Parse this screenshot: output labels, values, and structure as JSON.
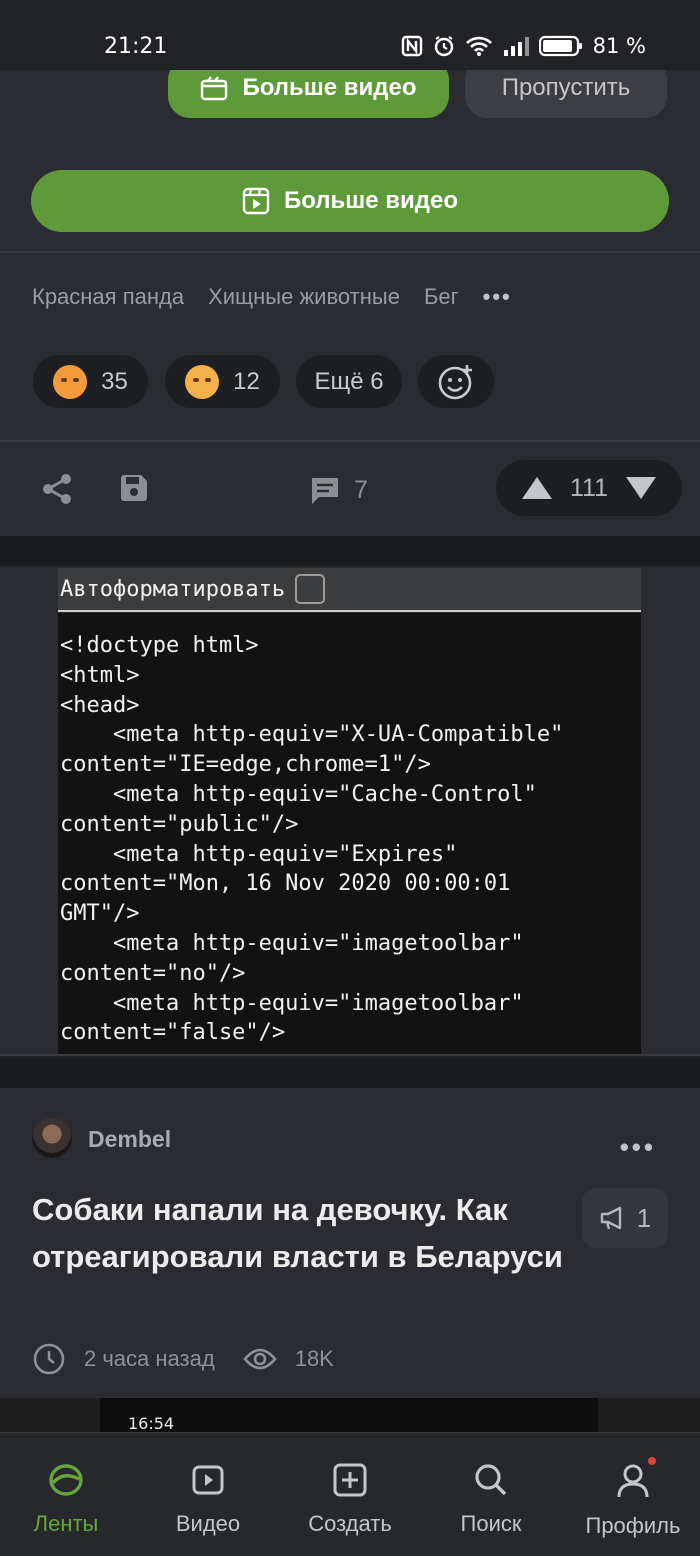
{
  "status": {
    "time": "21:21",
    "battery": "81 %"
  },
  "top_buttons": {
    "more_video_small": "Больше видео",
    "skip": "Пропустить",
    "more_video_big": "Больше видео"
  },
  "tags": [
    "Красная панда",
    "Хищные животные",
    "Бег"
  ],
  "reactions": [
    {
      "emoji": "smiling-face-with-hearts-icon",
      "count": "35"
    },
    {
      "emoji": "sad-face-icon",
      "count": "12"
    }
  ],
  "reactions_more": "Ещё 6",
  "actions": {
    "comments": "7",
    "rating": "111"
  },
  "code_block": {
    "autoformat_label": "Автоформатировать",
    "code": "<!doctype html>\n<html>\n<head>\n    <meta http-equiv=\"X-UA-Compatible\"\ncontent=\"IE=edge,chrome=1\"/>\n    <meta http-equiv=\"Cache-Control\"\ncontent=\"public\"/>\n    <meta http-equiv=\"Expires\"\ncontent=\"Mon, 16 Nov 2020 00:00:01\nGMT\"/>\n    <meta http-equiv=\"imagetoolbar\"\ncontent=\"no\"/>\n    <meta http-equiv=\"imagetoolbar\"\ncontent=\"false\"/>"
  },
  "post": {
    "author": "Dembel",
    "title": "Собаки напали на девочку. Как отреагировали власти в Беларуси",
    "comments": "1",
    "time": "2 часа назад",
    "views": "18K"
  },
  "preview": {
    "time": "16:54"
  },
  "tabbar": [
    {
      "label": "Ленты",
      "icon": "feeds-icon"
    },
    {
      "label": "Видео",
      "icon": "video-icon"
    },
    {
      "label": "Создать",
      "icon": "create-icon"
    },
    {
      "label": "Поиск",
      "icon": "search-icon"
    },
    {
      "label": "Профиль",
      "icon": "profile-icon"
    }
  ],
  "colors": {
    "accent": "#67a53c",
    "button_green": "#5f9a3a",
    "background": "#212327",
    "card": "#2a2c31"
  }
}
